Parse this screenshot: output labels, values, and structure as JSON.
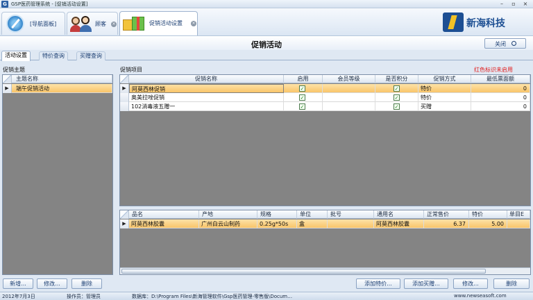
{
  "window": {
    "title": "GSP医药管理系统 - [促销活动设置]",
    "controls": [
      "–",
      "▫",
      "×"
    ]
  },
  "module_tabs": [
    {
      "label": "[导航面板]",
      "icon": "compass-icon",
      "closable": false
    },
    {
      "label": "顾客",
      "icon": "customers-icon",
      "closable": true
    },
    {
      "label": "促销活动设置",
      "icon": "gift-boxes-icon",
      "closable": true,
      "active": true
    }
  ],
  "logo": {
    "text": "新海科技"
  },
  "header": {
    "title": "促销活动",
    "close_label": "关闭"
  },
  "sub_tabs": [
    "活动设置",
    "特价查询",
    "买赠查询"
  ],
  "left_panel": {
    "section_label": "促销主题",
    "columns": [
      "主题名称"
    ],
    "rows": [
      {
        "name": "端午促销活动",
        "selected": true
      }
    ]
  },
  "promo_panel": {
    "section_label": "促销项目",
    "hint": "红色标识未启用",
    "columns": [
      "促销名称",
      "启用",
      "会员等级",
      "是否积分",
      "促销方式",
      "最低票面额"
    ],
    "rows": [
      {
        "name": "阿莫西林促销",
        "enabled": true,
        "member_level": "",
        "points": true,
        "method": "特价",
        "min_amount": "0",
        "selected": true
      },
      {
        "name": "奥美拉唑促销",
        "enabled": true,
        "member_level": "",
        "points": true,
        "method": "特价",
        "min_amount": "0",
        "selected": false
      },
      {
        "name": "102消毒液五赠一",
        "enabled": true,
        "member_level": "",
        "points": true,
        "method": "买赠",
        "min_amount": "0",
        "selected": false
      }
    ]
  },
  "product_panel": {
    "columns": [
      "品名",
      "产地",
      "规格",
      "单位",
      "批号",
      "通用名",
      "正常售价",
      "特价",
      "单目E"
    ],
    "rows": [
      {
        "name": "阿莫西林胶囊",
        "origin": "广州白云山制药",
        "spec": "0.25g*50s",
        "unit": "盒",
        "batch": "",
        "generic": "阿莫西林胶囊",
        "price": "6.37",
        "special": "5.00",
        "extra": ""
      }
    ]
  },
  "buttons": {
    "new": "新增...",
    "edit_left": "修改...",
    "delete_left": "删除",
    "add_special": "添加特价...",
    "add_gift": "添加买赠...",
    "edit_right": "修改...",
    "delete_right": "删除"
  },
  "status": {
    "date": "2012年7月3日",
    "operator": "操作员：管理员",
    "database": "数据库：D:\\Program Files\\新海管理软件\\Gsp医药管理-零售版\\Docum…",
    "website": "www.newseasoft.com"
  }
}
